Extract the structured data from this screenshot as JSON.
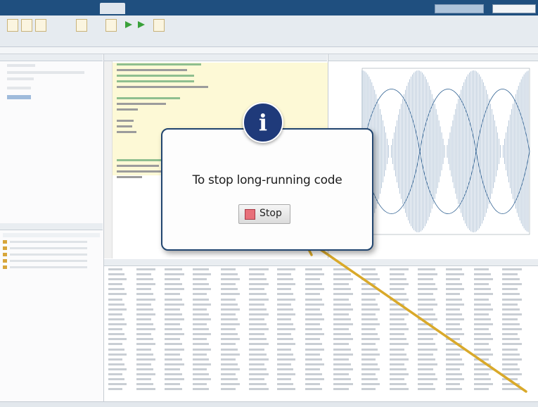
{
  "callout": {
    "message": "To stop long-running code",
    "icon": "info-icon",
    "stop_button_label": "Stop"
  },
  "colors": {
    "title_bar": "#1f4f7f",
    "callout_border": "#21456f",
    "info_badge": "#1f3a7a",
    "stop_square": "#e8707a",
    "arrow": "#d9a92a",
    "plot_line": "#2a5d8f",
    "editor_highlight": "#fdf9d6"
  }
}
